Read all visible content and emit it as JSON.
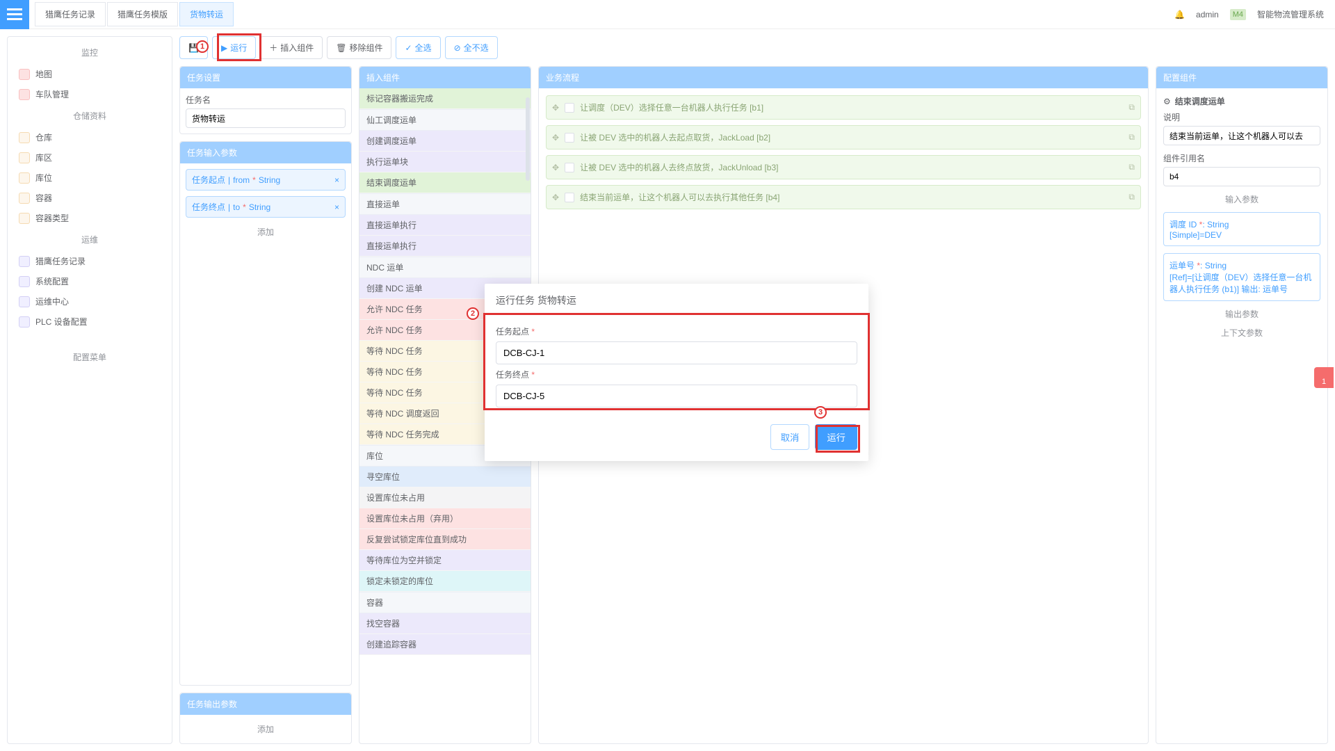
{
  "header": {
    "tabs": [
      "猎鹰任务记录",
      "猎鹰任务模版",
      "货物转运"
    ],
    "active_tab": 2,
    "user": "admin",
    "badge": "M4",
    "system_name": "智能物流管理系统"
  },
  "sidebar": {
    "groups": [
      {
        "title": "监控",
        "items": [
          {
            "label": "地图",
            "color": "red"
          },
          {
            "label": "车队管理",
            "color": "red"
          }
        ]
      },
      {
        "title": "仓储资料",
        "items": [
          {
            "label": "仓库"
          },
          {
            "label": "库区"
          },
          {
            "label": "库位"
          },
          {
            "label": "容器"
          },
          {
            "label": "容器类型"
          }
        ]
      },
      {
        "title": "运维",
        "items": [
          {
            "label": "猎鹰任务记录"
          },
          {
            "label": "系统配置"
          },
          {
            "label": "运维中心"
          },
          {
            "label": "PLC 设备配置"
          }
        ]
      }
    ],
    "config_menu": "配置菜单"
  },
  "toolbar": {
    "save_icon": "save",
    "run": "运行",
    "insert": "插入组件",
    "remove": "移除组件",
    "select_all": "全选",
    "deselect_all": "全不选"
  },
  "annots": {
    "a1": "1",
    "a2": "2",
    "a3": "3"
  },
  "task_settings": {
    "header": "任务设置",
    "name_label": "任务名",
    "name_value": "货物转运"
  },
  "task_input": {
    "header": "任务输入参数",
    "params": [
      {
        "name": "任务起点",
        "field": "from",
        "type": "String"
      },
      {
        "name": "任务终点",
        "field": "to",
        "type": "String"
      }
    ],
    "add": "添加"
  },
  "task_output": {
    "header": "任务输出参数",
    "add": "添加"
  },
  "insert_panel": {
    "header": "插入组件",
    "groups": [
      {
        "title_hidden": true,
        "items": [
          {
            "t": "标记容器搬运完成",
            "c": "green"
          }
        ]
      },
      {
        "title": "仙工调度运单",
        "items": [
          {
            "t": "创建调度运单",
            "c": "purple"
          },
          {
            "t": "执行运单块",
            "c": "purple"
          },
          {
            "t": "结束调度运单",
            "c": "green"
          }
        ]
      },
      {
        "title": "直接运单",
        "items": [
          {
            "t": "直接运单执行",
            "c": "purple"
          },
          {
            "t": "直接运单执行",
            "c": "purple"
          }
        ]
      },
      {
        "title": "NDC 运单",
        "items": [
          {
            "t": "创建 NDC 运单",
            "c": "purple"
          },
          {
            "t": "允许 NDC 任务",
            "c": "pink"
          },
          {
            "t": "允许 NDC 任务",
            "c": "pink"
          },
          {
            "t": "等待 NDC 任务",
            "c": "yellow"
          },
          {
            "t": "等待 NDC 任务",
            "c": "yellow"
          },
          {
            "t": "等待 NDC 任务",
            "c": "yellow"
          },
          {
            "t": "等待 NDC 调度返回",
            "c": "yellow"
          },
          {
            "t": "等待 NDC 任务完成",
            "c": "yellow"
          }
        ]
      },
      {
        "title": "库位",
        "items": [
          {
            "t": "寻空库位",
            "c": "blue"
          },
          {
            "t": "设置库位未占用",
            "c": "gray"
          },
          {
            "t": "设置库位未占用（弃用）",
            "c": "pink"
          },
          {
            "t": "反复尝试锁定库位直到成功",
            "c": "pink"
          },
          {
            "t": "等待库位为空并锁定",
            "c": "purple"
          },
          {
            "t": "锁定未锁定的库位",
            "c": "cyan"
          }
        ]
      },
      {
        "title": "容器",
        "items": [
          {
            "t": "找空容器",
            "c": "purple"
          },
          {
            "t": "创建追踪容器",
            "c": "purple"
          }
        ]
      }
    ]
  },
  "flow": {
    "header": "业务流程",
    "items": [
      "让调度（DEV）选择任意一台机器人执行任务 [b1]",
      "让被 DEV 选中的机器人去起点取货，JackLoad [b2]",
      "让被 DEV 选中的机器人去终点放货，JackUnload [b3]",
      "结束当前运单，让这个机器人可以去执行其他任务 [b4]"
    ]
  },
  "config": {
    "header": "配置组件",
    "title_line": "结束调度运单",
    "desc_label": "说明",
    "desc_value": "结束当前运单，让这个机器人可以去",
    "ref_label": "组件引用名",
    "ref_value": "b4",
    "input_params_title": "输入参数",
    "params": [
      {
        "name": "调度 ID",
        "type": "String",
        "detail": "[Simple]=DEV"
      },
      {
        "name": "运单号",
        "type": "String",
        "detail": "[Ref]=[让调度（DEV）选择任意一台机器人执行任务 (b1)] 输出: 运单号"
      }
    ],
    "output_params_title": "输出参数",
    "context_params_title": "上下文参数"
  },
  "modal": {
    "title": "运行任务 货物转运",
    "f1_label": "任务起点",
    "f1_value": "DCB-CJ-1",
    "f2_label": "任务终点",
    "f2_value": "DCB-CJ-5",
    "cancel": "取消",
    "run": "运行"
  },
  "float_badge": "1"
}
